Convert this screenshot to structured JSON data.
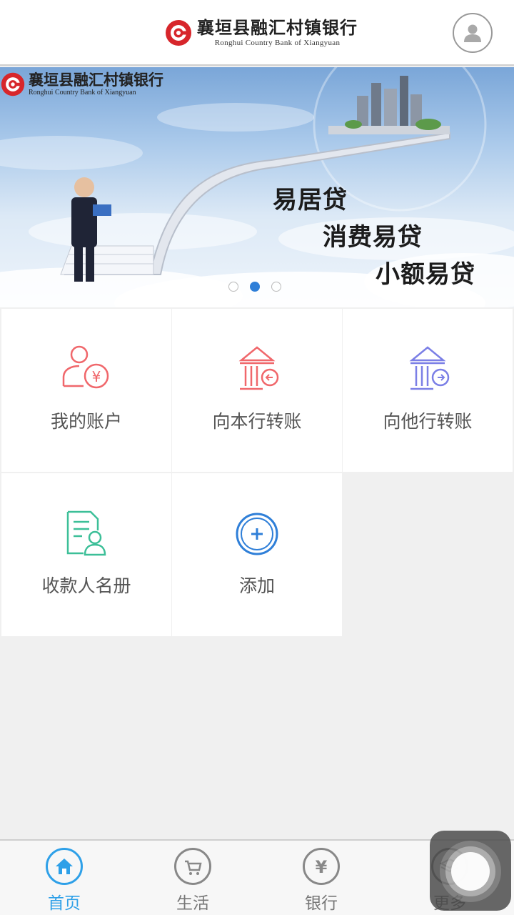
{
  "header": {
    "bank_name_cn": "襄垣县融汇村镇银行",
    "bank_name_en": "Ronghui Country Bank of Xiangyuan"
  },
  "banner": {
    "logo_cn": "襄垣县融汇村镇银行",
    "logo_en": "Ronghui Country Bank of Xiangyuan",
    "slogans": [
      "易居贷",
      "消费易贷",
      "小额易贷"
    ],
    "pager": {
      "count": 3,
      "active_index": 1
    }
  },
  "menu": {
    "items": [
      {
        "label": "我的账户",
        "icon": "account-yen-icon",
        "color": "#f0676b"
      },
      {
        "label": "向本行转账",
        "icon": "bank-transfer-in-icon",
        "color": "#f0676b"
      },
      {
        "label": "向他行转账",
        "icon": "bank-transfer-out-icon",
        "color": "#7b7fe6"
      },
      {
        "label": "收款人名册",
        "icon": "payee-list-icon",
        "color": "#3cbf98"
      },
      {
        "label": "添加",
        "icon": "add-circle-icon",
        "color": "#2f7fd8"
      }
    ]
  },
  "tabbar": {
    "items": [
      {
        "label": "首页",
        "icon": "home-icon",
        "active": true
      },
      {
        "label": "生活",
        "icon": "cart-icon",
        "active": false
      },
      {
        "label": "银行",
        "icon": "yen-icon",
        "active": false
      },
      {
        "label": "更多",
        "icon": "layers-icon",
        "active": false
      }
    ],
    "active_color": "#2ea0e8"
  },
  "colors": {
    "brand_red": "#d7262b",
    "accent_blue": "#2ea0e8"
  }
}
